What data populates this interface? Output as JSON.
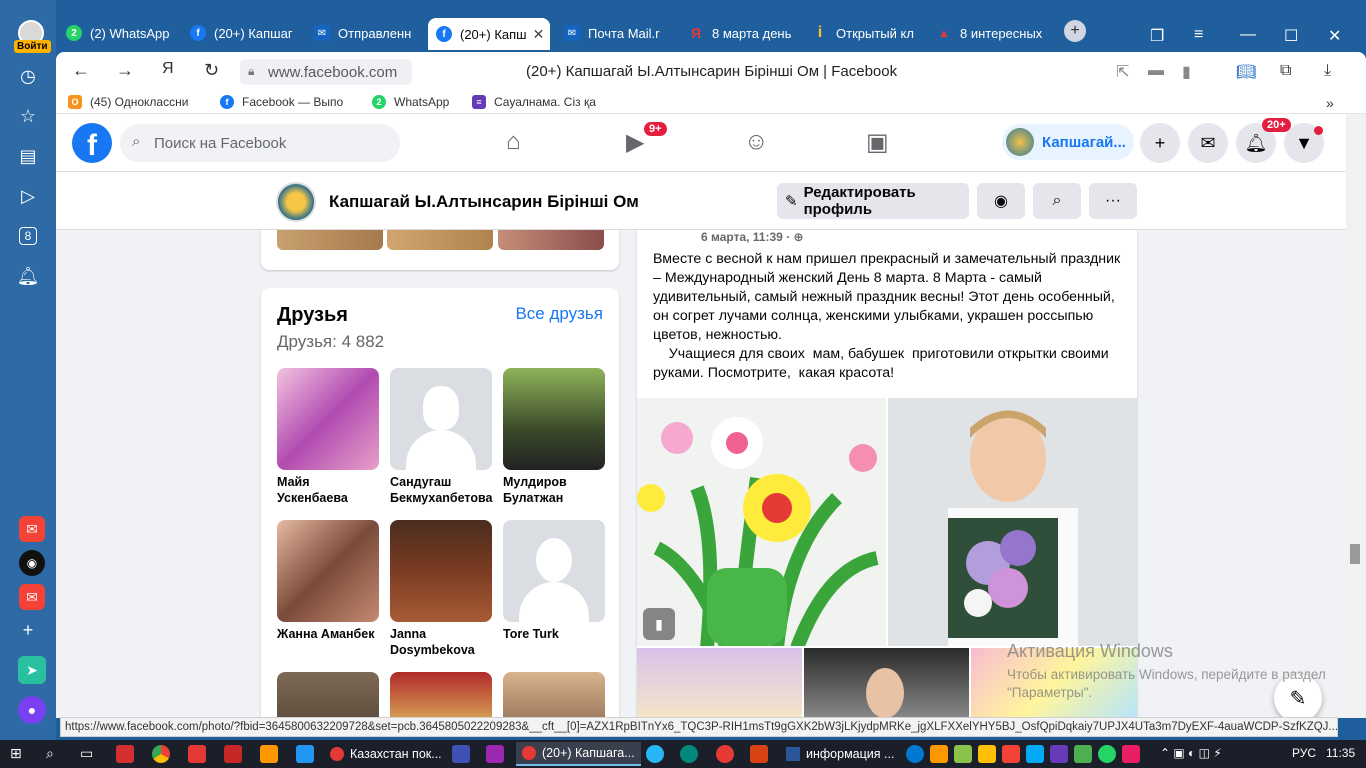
{
  "rail": {
    "login_label": "Войти",
    "icons": [
      "history-icon",
      "star-icon",
      "collections-icon",
      "play-icon",
      "tab-8-icon",
      "bell-icon",
      "mail-icon",
      "alice-icon",
      "mail2-icon",
      "plus-icon",
      "send-icon",
      "assistant-icon"
    ],
    "tab8": "8"
  },
  "tabs": [
    {
      "label": "(2) WhatsApp",
      "color": "#25d366",
      "glyph": "2"
    },
    {
      "label": "(20+) Капшаг",
      "color": "#1877f2",
      "glyph": "f"
    },
    {
      "label": "Отправленн",
      "color": "#1565c0",
      "glyph": "✉"
    },
    {
      "label": "(20+) Капш",
      "color": "#1877f2",
      "glyph": "f",
      "active": true
    },
    {
      "label": "Почта Mail.r",
      "color": "#1565c0",
      "glyph": "✉"
    },
    {
      "label": "8 марта день",
      "color": "#e53935",
      "glyph": "Я"
    },
    {
      "label": "Открытый кл",
      "color": "#fbc02d",
      "glyph": "i"
    },
    {
      "label": "8 интересных",
      "color": "#c62828",
      "glyph": "▲"
    }
  ],
  "address": {
    "url": "www.facebook.com",
    "title": "(20+) Капшагай Ы.Алтынсарин Бірінші Ом | Facebook"
  },
  "bookmarks": [
    {
      "label": "(45) Одноклассни",
      "color": "#f7931e",
      "glyph": "О"
    },
    {
      "label": "Facebook — Выпо",
      "color": "#1877f2",
      "glyph": "f"
    },
    {
      "label": "WhatsApp",
      "color": "#25d366",
      "glyph": "2"
    },
    {
      "label": "Сауалнама. Сіз қа",
      "color": "#673ab7",
      "glyph": "≡"
    }
  ],
  "fb": {
    "search_placeholder": "Поиск на Facebook",
    "watch_badge": "9+",
    "profile_chip": "Капшагай...",
    "notif_badge": "20+",
    "page_name": "Капшагай Ы.Алтынсарин Бірінші Ом",
    "edit_profile": "Редактировать профиль",
    "more": "···"
  },
  "friends": {
    "title": "Друзья",
    "all_link": "Все друзья",
    "count": "Друзья: 4 882",
    "list": [
      {
        "name": "Майя Ускенбаева",
        "kind": "photo",
        "bg": "linear-gradient(135deg,#f3c3e0,#b14bb0 50%,#e8a0c8)"
      },
      {
        "name": "Сандугаш Бекмухanбетова",
        "kind": "silhouette-f"
      },
      {
        "name": "Мулдиров Булатжан",
        "kind": "photo",
        "bg": "linear-gradient(180deg,#8fb35a,#3b4a2a 60%,#222)"
      },
      {
        "name": "Жанна Аманбек",
        "kind": "photo",
        "bg": "linear-gradient(135deg,#e6b9a1,#7a4b3a 50%,#c58a72)"
      },
      {
        "name": "Janna Dosymbekova",
        "kind": "photo",
        "bg": "linear-gradient(180deg,#4a2c1e,#7b3c22 50%,#a85b36)"
      },
      {
        "name": "Tore Turk",
        "kind": "silhouette-m"
      },
      {
        "name": "",
        "kind": "photo",
        "bg": "linear-gradient(180deg,#7d6a55,#3d2f24)"
      },
      {
        "name": "",
        "kind": "photo",
        "bg": "linear-gradient(180deg,#b02a2a,#e0c060 60%,#7a1c1c)"
      },
      {
        "name": "",
        "kind": "photo",
        "bg": "linear-gradient(180deg,#d9b38c,#5a3a28)"
      }
    ]
  },
  "post": {
    "date": "6 марта, 11:39 · ⊕",
    "text": "Вместе с весной к нам пришел прекрасный и замечательный праздник – Международный женский День 8 марта. 8 Марта - самый удивительный, самый нежный праздник весны! Этот день особенный, он согрет лучами солнца, женскими улыбками, украшен россыпью цветов, нежностью.\n    Учащиеся для своих  мам, бабушек  приготовили открытки своими руками. Посмотрите,  какая красота!"
  },
  "watermark": {
    "title": "Активация Windows",
    "subtitle": "Чтобы активировать Windows, перейдите в раздел \"Параметры\"."
  },
  "status_url": "https://www.facebook.com/photo/?fbid=3645800632209728&set=pcb.3645805022209283&__cft__[0]=AZX1RpBITnYx6_TQC3P-RIH1msTt9gGXK2bW3jLKjydpMRKe_jgXLFXXelYHY5BJ_OsfQpiDqkaiy7UPJX4UTa3m7DyEXF-4auaWCDP-SzfKZQJ...",
  "taskbar": {
    "items": [
      {
        "label": "Казахстан пок...",
        "color": "#e53935"
      },
      {
        "label": "(20+) Капшага...",
        "color": "#e53935",
        "active": true
      },
      {
        "label": "информация ...",
        "color": "#2b579a"
      }
    ],
    "lang": "РУС",
    "time": "11:35"
  }
}
